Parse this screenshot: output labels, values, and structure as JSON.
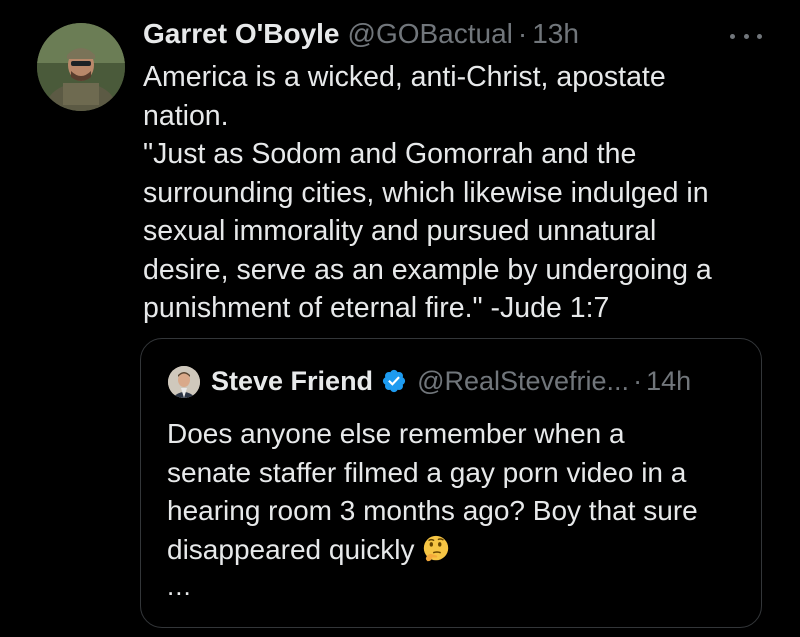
{
  "tweet": {
    "author": {
      "display_name": "Garret O'Boyle",
      "handle": "@GOBactual",
      "separator": "·",
      "time": "13h",
      "avatar_icon": "profile-photo-icon"
    },
    "more_icon": "ellipsis-icon",
    "lines": [
      "America is a wicked, anti-Christ, apostate",
      "nation.",
      "\"Just as Sodom and Gomorrah and the",
      "surrounding cities, which likewise indulged in",
      "sexual immorality and pursued unnatural",
      "desire, serve as an example by undergoing a",
      "punishment of eternal fire.\" -Jude 1:7"
    ]
  },
  "quote": {
    "author": {
      "display_name": "Steve Friend",
      "verified_icon": "verified-badge-icon",
      "handle": "@RealStevefrie...",
      "separator": "·",
      "time": "14h"
    },
    "lines": [
      "Does anyone else remember when a",
      "senate staffer filmed a gay porn video in a",
      "hearing room 3 months ago? Boy that sure",
      "disappeared quickly"
    ],
    "emoji_icon": "thinking-face-icon",
    "truncation": "..."
  },
  "colors": {
    "background": "#000000",
    "text": "#e7e9ea",
    "secondary": "#71767b",
    "border": "#333639",
    "verified": "#1d9bf0"
  }
}
